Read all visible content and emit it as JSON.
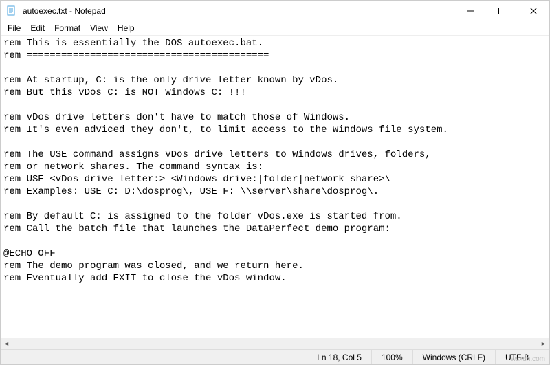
{
  "window": {
    "title": "autoexec.txt - Notepad"
  },
  "menu": {
    "file": "File",
    "edit": "Edit",
    "format": "Format",
    "view": "View",
    "help": "Help"
  },
  "editor": {
    "content": "rem This is essentially the DOS autoexec.bat.\nrem ==========================================\n\nrem At startup, C: is the only drive letter known by vDos.\nrem But this vDos C: is NOT Windows C: !!!\n\nrem vDos drive letters don't have to match those of Windows.\nrem It's even adviced they don't, to limit access to the Windows file system.\n\nrem The USE command assigns vDos drive letters to Windows drives, folders,\nrem or network shares. The command syntax is:\nrem USE <vDos drive letter:> <Windows drive:|folder|network share>\\\nrem Examples: USE C: D:\\dosprog\\, USE F: \\\\server\\share\\dosprog\\.\n\nrem By default C: is assigned to the folder vDos.exe is started from.\nrem Call the batch file that launches the DataPerfect demo program:\n\n@ECHO OFF\nrem The demo program was closed, and we return here.\nrem Eventually add EXIT to close the vDos window."
  },
  "icons": {
    "app": "notepad-icon",
    "minimize": "minimize-icon",
    "maximize": "maximize-icon",
    "close": "close-icon",
    "scroll_left": "chevron-left-icon",
    "scroll_right": "chevron-right-icon"
  },
  "status": {
    "position": "Ln 18, Col 5",
    "zoom": "100%",
    "line_ending": "Windows (CRLF)",
    "encoding": "UTF-8"
  },
  "watermark": "wsxdn.com"
}
